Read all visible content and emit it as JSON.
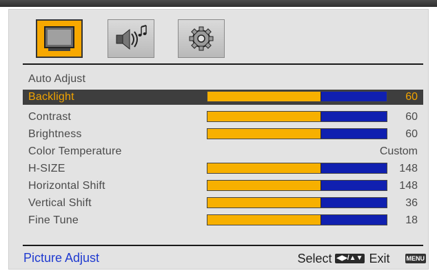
{
  "tabs": [
    {
      "icon": "monitor-icon",
      "active": true
    },
    {
      "icon": "speaker-music-icon",
      "active": false
    },
    {
      "icon": "gear-icon",
      "active": false
    }
  ],
  "menu": {
    "items": [
      {
        "label": "Auto  Adjust",
        "value": "",
        "fill": null,
        "selected": false
      },
      {
        "label": "Backlight",
        "value": "60",
        "fill": 0.63,
        "selected": true
      },
      {
        "label": "Contrast",
        "value": "60",
        "fill": 0.63,
        "selected": false
      },
      {
        "label": "Brightness",
        "value": "60",
        "fill": 0.63,
        "selected": false
      },
      {
        "label": "Color  Temperature",
        "value": "Custom",
        "fill": null,
        "selected": false
      },
      {
        "label": "H-SIZE",
        "value": "148",
        "fill": 0.63,
        "selected": false
      },
      {
        "label": "Horizontal  Shift",
        "value": "148",
        "fill": 0.63,
        "selected": false
      },
      {
        "label": "Vertical  Shift",
        "value": "36",
        "fill": 0.63,
        "selected": false
      },
      {
        "label": "Fine  Tune",
        "value": "18",
        "fill": 0.63,
        "selected": false
      }
    ]
  },
  "footer": {
    "title": "Picture  Adjust",
    "select_label": "Select",
    "select_key": "◀▶/▲▼",
    "exit_label": "Exit",
    "exit_key": "MENU"
  },
  "colors": {
    "accent": "#f7b000",
    "bar_empty": "#1020b0",
    "selected_row": "#3e3e3e",
    "footer_title": "#1f3ad0"
  }
}
